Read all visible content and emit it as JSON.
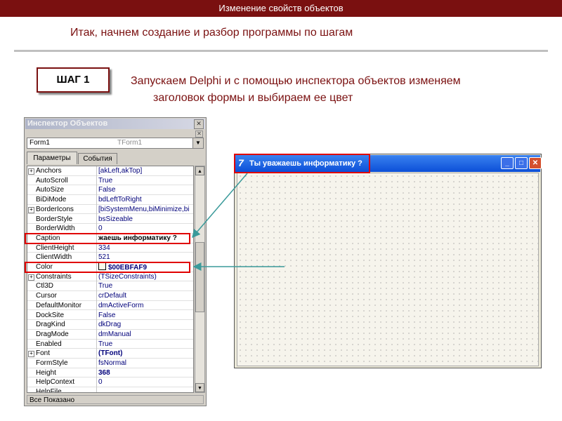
{
  "header": {
    "title": "Изменение свойств объектов"
  },
  "subtitle": "Итак, начнем создание и разбор программы по шагам",
  "step": {
    "label": "ШАГ 1",
    "description_line1": "Запускаем Delphi и с помощью инспектора объектов изменяем",
    "description_line2": "заголовок формы и выбираем ее цвет"
  },
  "inspector": {
    "title": "Инспектор Объектов",
    "object_name": "Form1",
    "object_type": "TForm1",
    "tabs": [
      "Параметры",
      "События"
    ],
    "status": "Все Показано",
    "properties": [
      {
        "name": "Anchors",
        "value": "[akLeft,akTop]",
        "expand": "+"
      },
      {
        "name": "AutoScroll",
        "value": "True"
      },
      {
        "name": "AutoSize",
        "value": "False"
      },
      {
        "name": "BiDiMode",
        "value": "bdLeftToRight"
      },
      {
        "name": "BorderIcons",
        "value": "[biSystemMenu,biMinimize,bi",
        "expand": "+"
      },
      {
        "name": "BorderStyle",
        "value": "bsSizeable"
      },
      {
        "name": "BorderWidth",
        "value": "0"
      },
      {
        "name": "Caption",
        "value": "жаешь информатику ?",
        "style": "bold"
      },
      {
        "name": "ClientHeight",
        "value": "334"
      },
      {
        "name": "ClientWidth",
        "value": "521"
      },
      {
        "name": "Color",
        "value": "$00EBFAF9",
        "style": "boldblue",
        "swatch": "#f9faeb"
      },
      {
        "name": "Constraints",
        "value": "(TSizeConstraints)",
        "expand": "+"
      },
      {
        "name": "Ctl3D",
        "value": "True"
      },
      {
        "name": "Cursor",
        "value": "crDefault"
      },
      {
        "name": "DefaultMonitor",
        "value": "dmActiveForm"
      },
      {
        "name": "DockSite",
        "value": "False"
      },
      {
        "name": "DragKind",
        "value": "dkDrag"
      },
      {
        "name": "DragMode",
        "value": "dmManual"
      },
      {
        "name": "Enabled",
        "value": "True"
      },
      {
        "name": "Font",
        "value": "(TFont)",
        "expand": "+",
        "style": "boldblue"
      },
      {
        "name": "FormStyle",
        "value": "fsNormal"
      },
      {
        "name": "Height",
        "value": "368",
        "style": "boldblue"
      },
      {
        "name": "HelpContext",
        "value": "0"
      },
      {
        "name": "HelpFile",
        "value": ""
      }
    ]
  },
  "form": {
    "caption": "Ты уважаешь информатику ?",
    "icon": "delphi-icon",
    "buttons": {
      "minimize": "_",
      "maximize": "□",
      "close": "✕"
    }
  },
  "colors": {
    "header": "#7a1010",
    "accent": "#7a1010",
    "highlight": "#e00000",
    "arrow": "#3a9a9a"
  }
}
